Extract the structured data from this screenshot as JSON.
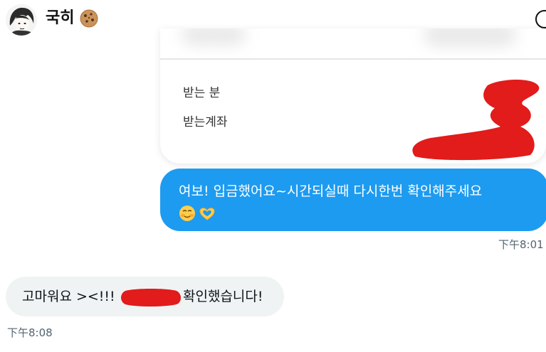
{
  "header": {
    "contact_name": "국히",
    "name_emoji": "cookie-icon",
    "info_icon": "info-icon"
  },
  "receipt_card": {
    "rows": [
      {
        "label": "받는 분"
      },
      {
        "label": "받는계좌"
      }
    ],
    "redaction_color": "#e21b1b"
  },
  "messages": [
    {
      "direction": "outgoing",
      "text": "여보! 입금했어요~시간되실때 다시한번 확인해주세요",
      "emojis": [
        "smiling-face-icon",
        "heart-hands-icon"
      ],
      "timestamp": "下午8:01",
      "bubble_color": "#1d9bf0"
    },
    {
      "direction": "incoming",
      "text_before_redaction": "고마워요 ><!!!",
      "text_after_redaction": "확인했습니다!",
      "timestamp": "下午8:08",
      "bubble_color": "#eff3f4"
    }
  ]
}
